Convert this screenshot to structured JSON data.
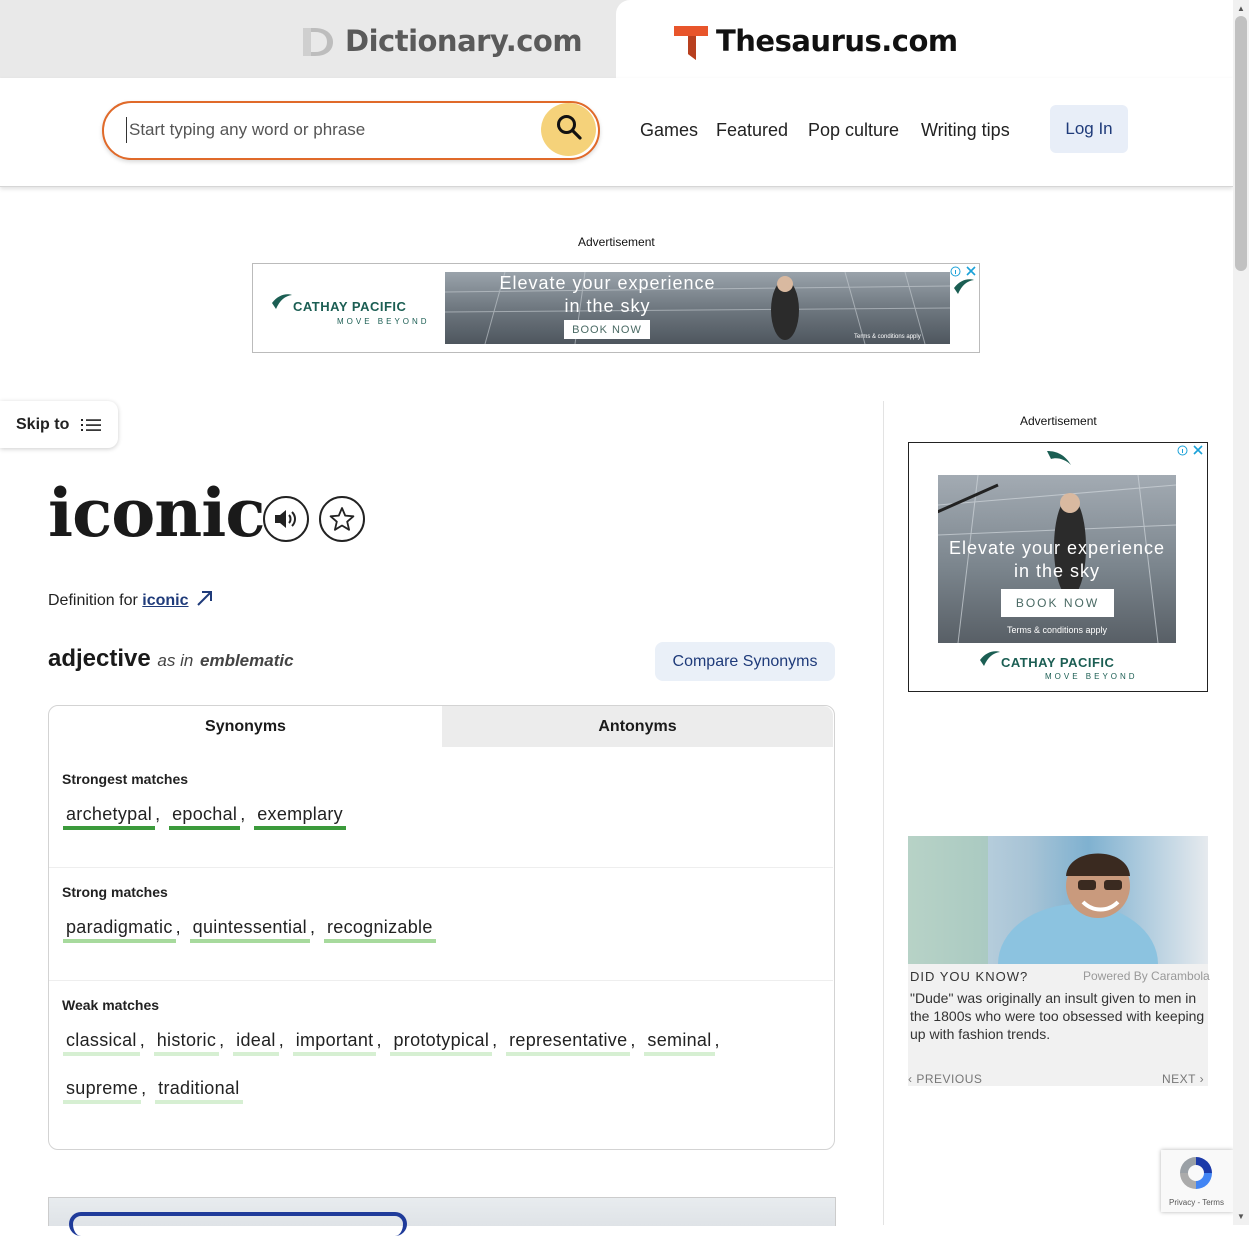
{
  "tabs": {
    "dictionary": "Dictionary.com",
    "thesaurus": "Thesaurus.com"
  },
  "search": {
    "placeholder": "Start typing any word or phrase"
  },
  "nav": {
    "items": [
      "Games",
      "Featured",
      "Pop culture",
      "Writing tips"
    ],
    "login": "Log In"
  },
  "ads": {
    "label": "Advertisement",
    "banner_headline_1": "Elevate your experience",
    "banner_headline_2": "in the sky",
    "book_now": "BOOK NOW",
    "brand": "CATHAY PACIFIC",
    "brand_sub": "MOVE BEYOND",
    "terms": "Terms & conditions apply",
    "terms_apply": "Terms & conditions apply"
  },
  "skip": {
    "label": "Skip to"
  },
  "entry": {
    "word": "iconic",
    "definition_prefix": "Definition for",
    "definition_link": "iconic",
    "part_of_speech": "adjective",
    "as_in_prefix": "as in",
    "as_in": "emblematic",
    "compare_button": "Compare Synonyms"
  },
  "word_tabs": {
    "synonyms": "Synonyms",
    "antonyms": "Antonyms"
  },
  "groups": {
    "strongest": {
      "title": "Strongest matches",
      "words": [
        "archetypal",
        "epochal",
        "exemplary"
      ]
    },
    "strong": {
      "title": "Strong matches",
      "words": [
        "paradigmatic",
        "quintessential",
        "recognizable"
      ]
    },
    "weak": {
      "title": "Weak matches",
      "words": [
        "classical",
        "historic",
        "ideal",
        "important",
        "prototypical",
        "representative",
        "seminal",
        "supreme",
        "traditional"
      ]
    }
  },
  "did_you_know": {
    "title": "DID YOU KNOW?",
    "powered_by": "Powered By Carambola",
    "text": "\"Dude\" was originally an insult given to men in the 1800s who were too obsessed with keeping up with fashion trends.",
    "previous": "PREVIOUS",
    "next": "NEXT"
  },
  "recaptcha": {
    "links": "Privacy - Terms"
  },
  "colors": {
    "accent_orange": "#e06a2a",
    "link_blue": "#1f3b7a",
    "strongest_green": "#3b9a3b",
    "strong_green": "#a7da9d",
    "weak_green": "#d6efd2"
  }
}
